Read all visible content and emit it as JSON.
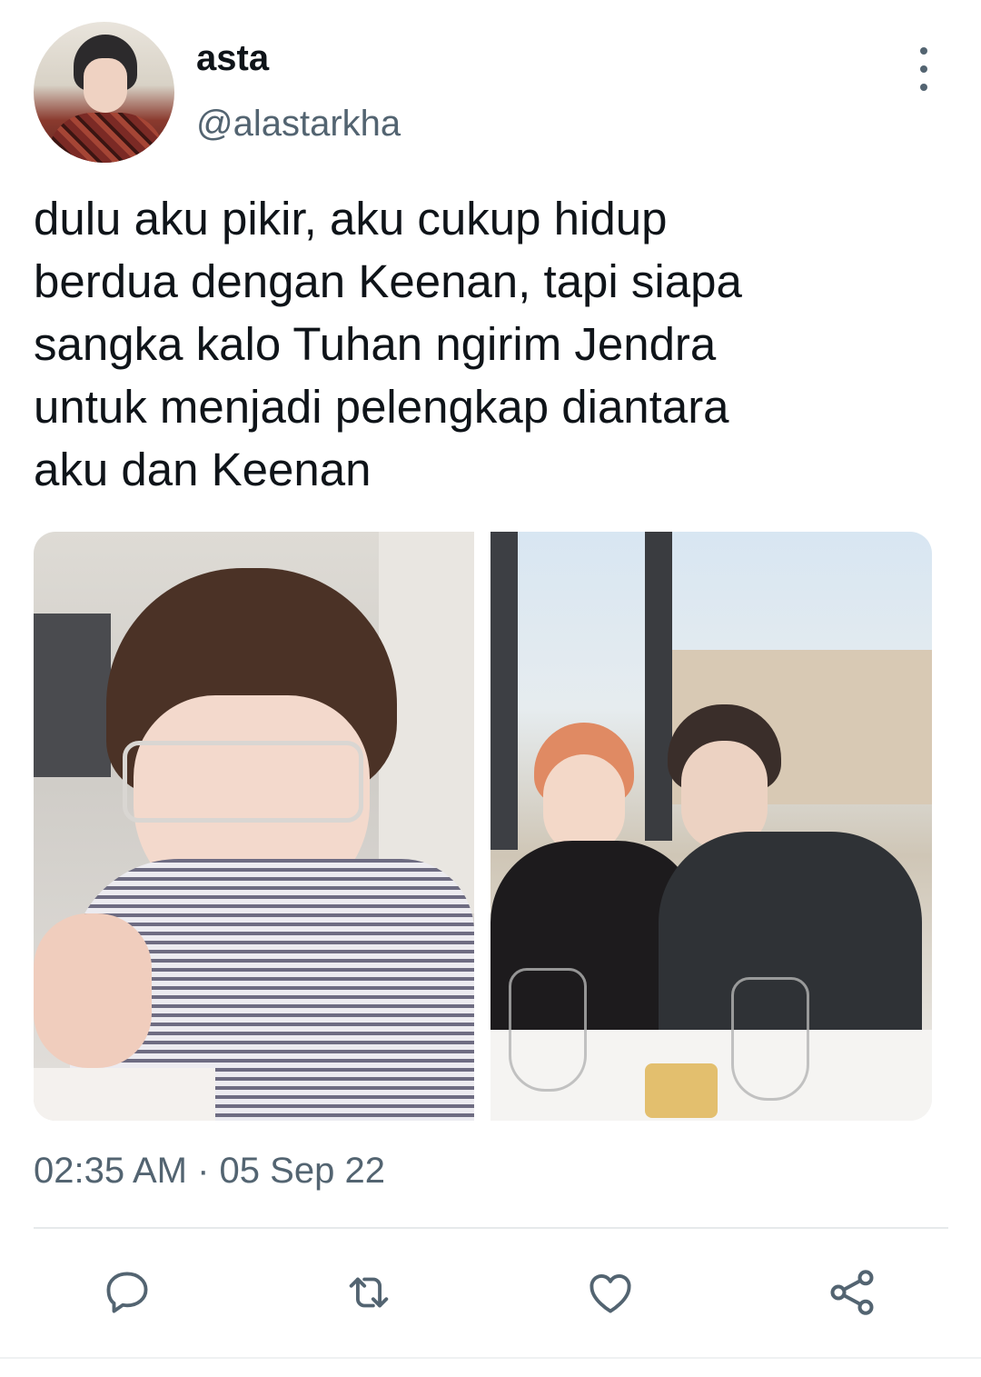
{
  "author": {
    "display_name": "asta",
    "handle": "@alastarkha",
    "avatar_icon": "user-avatar"
  },
  "tweet": {
    "text": "dulu aku pikir, aku cukup hidup\nberdua dengan Keenan, tapi siapa\nsangka kalo Tuhan ngirim Jendra\nuntuk menjadi pelengkap diantara\naku dan Keenan",
    "timestamp": "02:35 AM · 05 Sep 22"
  },
  "media": [
    {
      "name": "photo-child-with-glasses"
    },
    {
      "name": "photo-two-men-at-table"
    }
  ],
  "actions": [
    {
      "name": "reply",
      "icon": "reply-icon"
    },
    {
      "name": "retweet",
      "icon": "retweet-icon"
    },
    {
      "name": "like",
      "icon": "heart-icon"
    },
    {
      "name": "share",
      "icon": "share-icon"
    }
  ],
  "colors": {
    "text_primary": "#0f1419",
    "text_secondary": "#536471",
    "divider": "#e6e9eb"
  }
}
